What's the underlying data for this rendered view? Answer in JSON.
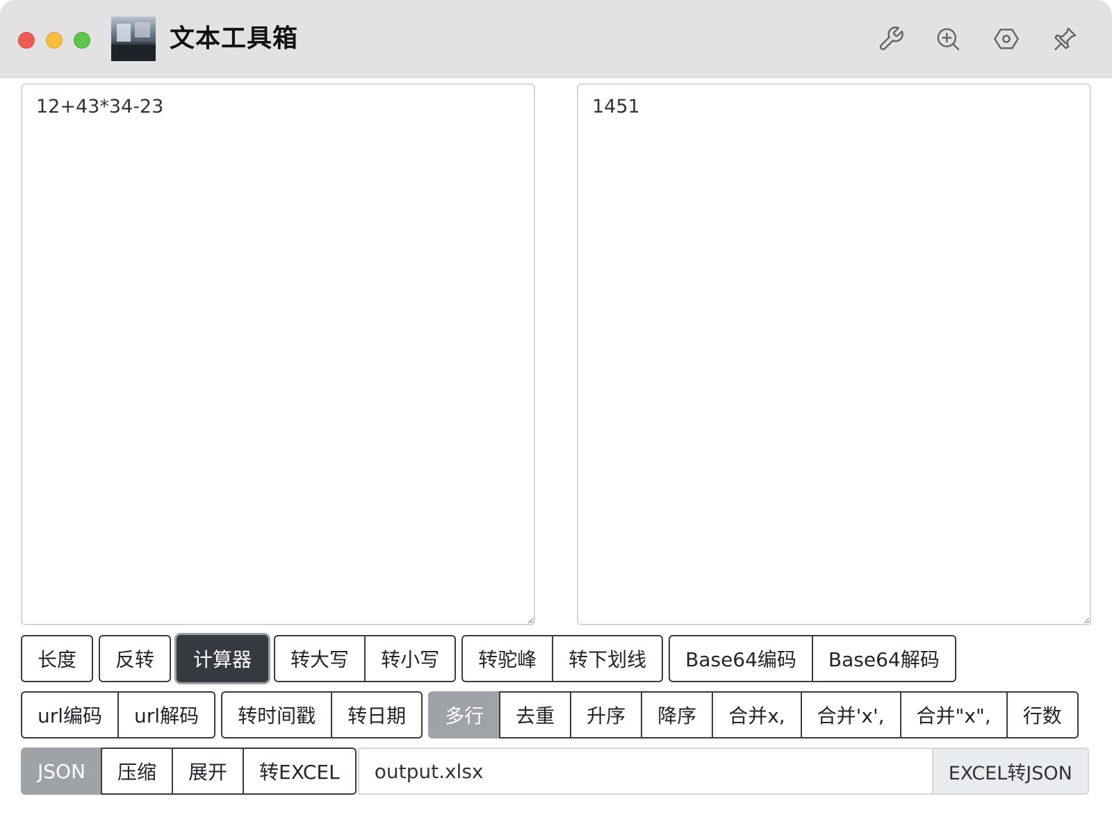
{
  "window": {
    "title": "文本工具箱",
    "colors": {
      "close": "#ee5c56",
      "minimize": "#f6be3e",
      "zoom": "#5ec44a",
      "titlebar": "#e2e2e2"
    },
    "toolbar_icons": [
      "wrench-icon",
      "zoom-in-icon",
      "hexagon-settings-icon",
      "pin-icon"
    ]
  },
  "editor": {
    "input_text": "12+43*34-23",
    "output_text": "1451"
  },
  "buttons": {
    "row1": [
      [
        "长度"
      ],
      [
        "反转"
      ],
      [
        "计算器"
      ],
      [
        "转大写",
        "转小写"
      ],
      [
        "转驼峰",
        "转下划线"
      ],
      [
        "Base64编码",
        "Base64解码"
      ]
    ],
    "row2": [
      [
        "url编码",
        "url解码"
      ],
      [
        "转时间戳",
        "转日期"
      ],
      [
        "多行",
        "去重",
        "升序",
        "降序",
        "合并x,",
        "合并'x',",
        "合并\"x\",",
        "行数"
      ]
    ],
    "row3": [
      "JSON",
      "压缩",
      "展开",
      "转EXCEL"
    ],
    "active": "计算器",
    "gray": [
      "多行",
      "JSON"
    ]
  },
  "excel": {
    "filename": "output.xlsx",
    "button_label": "EXCEL转JSON"
  }
}
